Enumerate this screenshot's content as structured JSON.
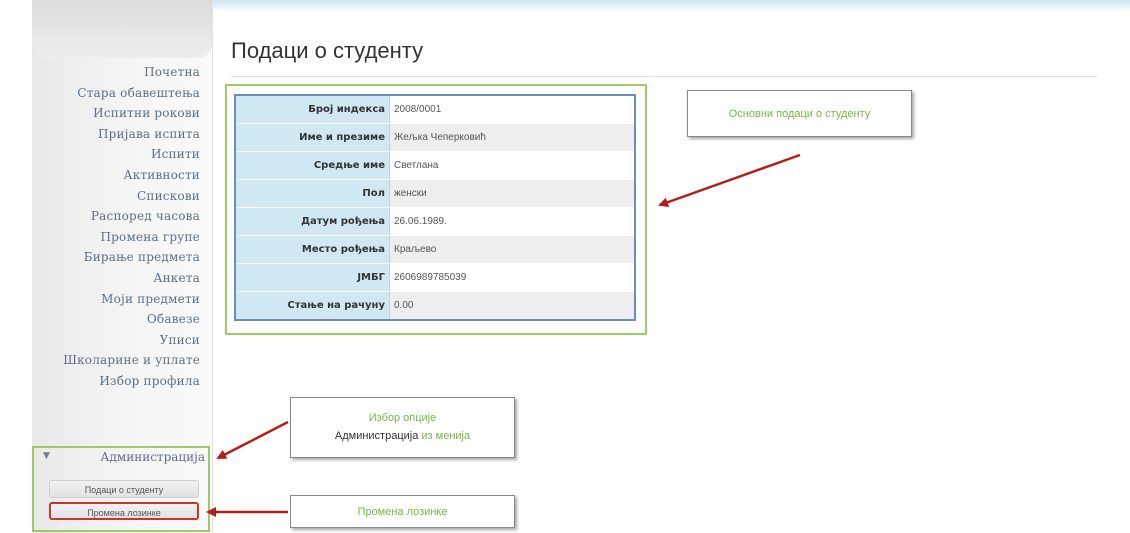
{
  "page": {
    "title": "Подаци о студенту"
  },
  "sidebar": {
    "items": [
      {
        "label": "Почетна"
      },
      {
        "label": "Стара обавештења"
      },
      {
        "label": "Испитни рокови"
      },
      {
        "label": "Пријава испита"
      },
      {
        "label": "Испити"
      },
      {
        "label": "Активности"
      },
      {
        "label": "Спискови"
      },
      {
        "label": "Распоред часова"
      },
      {
        "label": "Промена групе"
      },
      {
        "label": "Бирање предмета"
      },
      {
        "label": "Анкета"
      },
      {
        "label": "Моји предмети"
      },
      {
        "label": "Обавезе"
      },
      {
        "label": "Уписи"
      },
      {
        "label": "Школарине и уплате"
      },
      {
        "label": "Избор профила"
      }
    ],
    "admin": {
      "label": "Администрација",
      "expanded": true,
      "sub_items": [
        {
          "label": "Подаци о студенту",
          "selected": false
        },
        {
          "label": "Промена лозинке",
          "selected": true
        }
      ]
    }
  },
  "student_info": {
    "rows": [
      {
        "label": "Број индекса",
        "value": "2008/0001"
      },
      {
        "label": "Име и презиме",
        "value": "Жељка Чеперковић"
      },
      {
        "label": "Средње име",
        "value": "Светлана"
      },
      {
        "label": "Пол",
        "value": "женски"
      },
      {
        "label": "Датум рођења",
        "value": "26.06.1989."
      },
      {
        "label": "Место рођења",
        "value": "Краљево"
      },
      {
        "label": "ЈМБГ",
        "value": "2606989785039"
      },
      {
        "label": "Стање на рачуну",
        "value": "0.00"
      }
    ]
  },
  "callouts": {
    "basic_info": "Основни подаци о студенту",
    "choose_option_line1": "Избор опције",
    "choose_option_admin": "Администрација",
    "choose_option_suffix": " из менија",
    "change_password": "Промена лозинке"
  },
  "colors": {
    "highlight_green": "#9ccc65",
    "arrow_red": "#b71c1c",
    "label_bg": "#cfe8f2",
    "menu_text": "#5a6f88"
  }
}
